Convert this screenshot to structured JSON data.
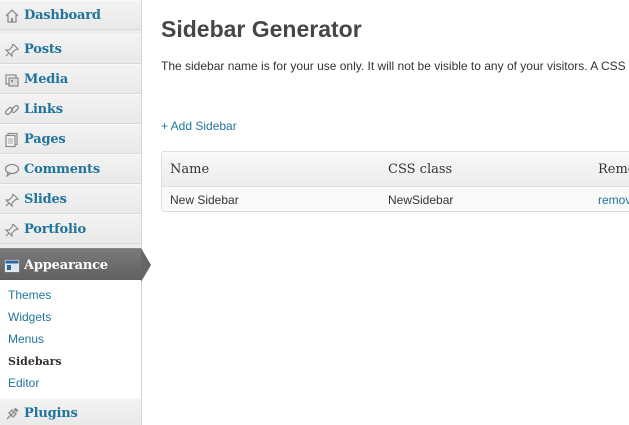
{
  "sidebar": {
    "items": [
      {
        "label": "Dashboard",
        "icon": "home-icon"
      },
      {
        "label": "Posts",
        "icon": "pushpin-icon"
      },
      {
        "label": "Media",
        "icon": "media-icon"
      },
      {
        "label": "Links",
        "icon": "link-icon"
      },
      {
        "label": "Pages",
        "icon": "pages-icon"
      },
      {
        "label": "Comments",
        "icon": "comment-icon"
      },
      {
        "label": "Slides",
        "icon": "pushpin-icon"
      },
      {
        "label": "Portfolio",
        "icon": "pushpin-icon"
      },
      {
        "label": "Appearance",
        "icon": "appearance-icon",
        "active": true
      },
      {
        "label": "Plugins",
        "icon": "plugin-icon"
      }
    ],
    "submenu": [
      {
        "label": "Themes"
      },
      {
        "label": "Widgets"
      },
      {
        "label": "Menus"
      },
      {
        "label": "Sidebars",
        "current": true
      },
      {
        "label": "Editor"
      }
    ]
  },
  "main": {
    "title": "Sidebar Generator",
    "intro": "The sidebar name is for your use only. It will not be visible to any of your visitors. A CSS",
    "add_link": "+ Add Sidebar",
    "table": {
      "headers": [
        "Name",
        "CSS class",
        "Remo"
      ],
      "rows": [
        [
          "New Sidebar",
          "NewSidebar",
          "remov"
        ]
      ]
    }
  },
  "colors": {
    "link": "#21759b",
    "sidebar_bg": "#ececec",
    "active_bg": "#6d6d6d"
  }
}
